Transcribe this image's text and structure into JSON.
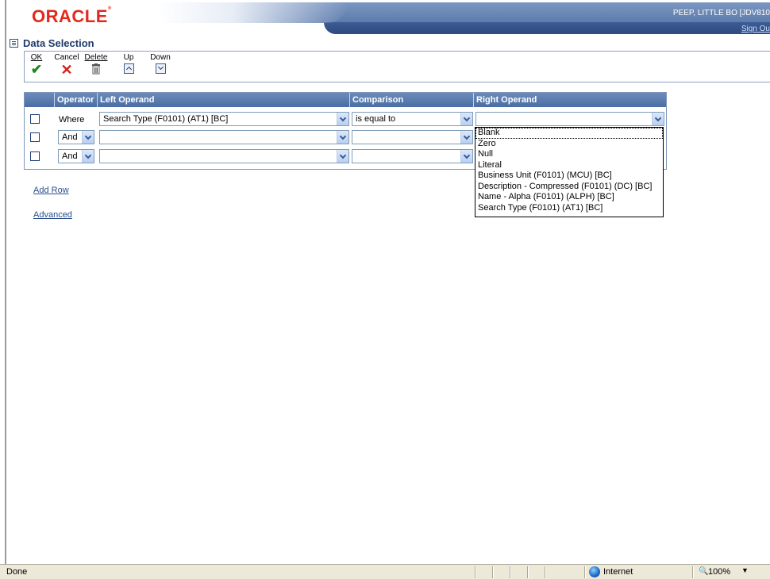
{
  "header": {
    "logo": "ORACLE",
    "user": "PEEP, LITTLE BO  [JDV810",
    "signout": "Sign Ou"
  },
  "page_title": "Data Selection",
  "toolbar": {
    "ok": "OK",
    "cancel": "Cancel",
    "delete": "Delete",
    "up": "Up",
    "down": "Down"
  },
  "grid": {
    "columns": [
      "Operator",
      "Left Operand",
      "Comparison",
      "Right Operand"
    ],
    "rows": [
      {
        "operator": "Where",
        "left": "Search Type (F0101) (AT1) [BC]",
        "comparison": "is equal to",
        "right": ""
      },
      {
        "operator": "And",
        "left": "",
        "comparison": "",
        "right": ""
      },
      {
        "operator": "And",
        "left": "",
        "comparison": "",
        "right": ""
      }
    ]
  },
  "right_operand_options": [
    "Blank",
    "Zero",
    "Null",
    "Literal",
    "Business Unit (F0101) (MCU) [BC]",
    "Description - Compressed (F0101) (DC) [BC]",
    "Name - Alpha (F0101) (ALPH) [BC]",
    "Search Type (F0101) (AT1) [BC]"
  ],
  "links": {
    "add_row": "Add Row",
    "advanced": "Advanced"
  },
  "statusbar": {
    "status": "Done",
    "zone": "Internet",
    "zoom": "100%"
  }
}
